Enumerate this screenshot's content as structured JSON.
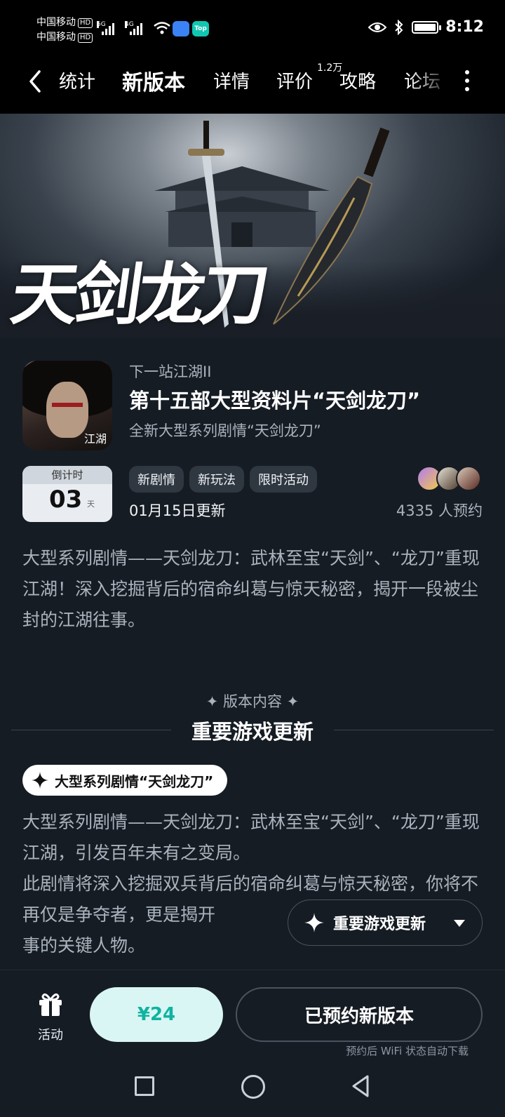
{
  "status_bar": {
    "carrier_1": "中国移动",
    "carrier_2": "中国移动",
    "hd_label": "HD",
    "net_1": "5G",
    "net_2": "4G",
    "app_badge": "Top",
    "time": "8:12"
  },
  "nav": {
    "tabs": [
      {
        "label": "统计",
        "active": false
      },
      {
        "label": "新版本",
        "active": true
      },
      {
        "label": "详情",
        "active": false
      },
      {
        "label": "评价",
        "active": false
      },
      {
        "label": "攻略",
        "active": false
      },
      {
        "label": "论坛",
        "active": false
      }
    ],
    "review_count_badge": "1.2万",
    "accent_color": "#10c8b1"
  },
  "banner": {
    "title_art": "天剑龙刀"
  },
  "game": {
    "name": "下一站江湖II",
    "icon_logo_text": "江湖",
    "headline": "第十五部大型资料片“天剑龙刀”",
    "subhead": "全新大型系列剧情“天剑龙刀”"
  },
  "countdown": {
    "label": "倒计时",
    "days": "03",
    "unit": "天"
  },
  "tags": [
    "新剧情",
    "新玩法",
    "限时活动"
  ],
  "update_date": "01月15日更新",
  "reserve_count": "4335 人预约",
  "description": "大型系列剧情——天剑龙刀：武林至宝“天剑”、“龙刀”重现江湖！深入挖掘背后的宿命纠葛与惊天秘密，揭开一段被尘封的江湖往事。",
  "section": {
    "kicker": "✦ 版本内容 ✦",
    "title": "重要游戏更新"
  },
  "feature": {
    "pill_label": "大型系列剧情“天剑龙刀”",
    "body_line_1": "大型系列剧情——天剑龙刀：武林至宝“天剑”、“龙刀”重现江湖，引发百年未有之变局。",
    "body_line_2": "此剧情将深入挖掘双兵背后的宿命纠葛与惊天秘密，你将不再仅是争夺者，更是揭开",
    "body_line_3": "事的关键人物。"
  },
  "floating_button": {
    "label": "重要游戏更新"
  },
  "bottom_bar": {
    "activity_label": "活动",
    "price": "¥24",
    "reserve_label": "已预约新版本",
    "wifi_note": "预约后 WiFi 状态自动下载"
  }
}
